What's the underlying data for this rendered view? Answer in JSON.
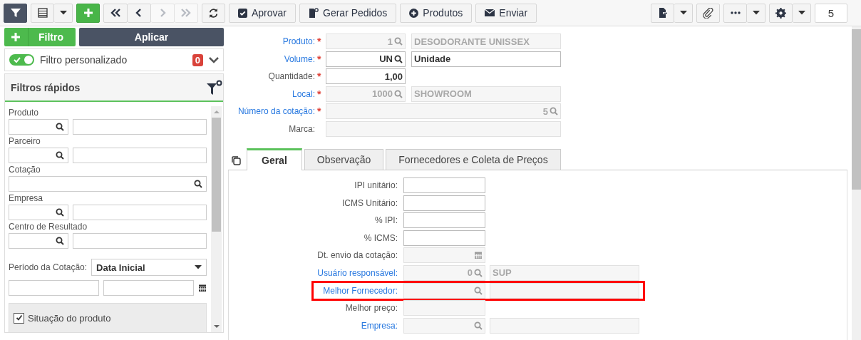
{
  "toolbar": {
    "nav": [
      {
        "disabled": false
      },
      {
        "disabled": false
      },
      {
        "disabled": true
      },
      {
        "disabled": true
      }
    ],
    "actions": [
      "Aprovar",
      "Gerar Pedidos",
      "Produtos",
      "Enviar"
    ],
    "record_count": "5"
  },
  "filter_panel": {
    "add_filter": "Filtro",
    "apply": "Aplicar",
    "custom_filter": {
      "label": "Filtro personalizado",
      "on": true,
      "count": "0"
    },
    "quick_filters": {
      "title": "Filtros rápidos",
      "fields": [
        {
          "kind": "lookup",
          "label": "Produto"
        },
        {
          "kind": "lookup",
          "label": "Parceiro"
        },
        {
          "kind": "search",
          "label": "Cotação"
        },
        {
          "kind": "lookup",
          "label": "Empresa"
        },
        {
          "kind": "lookup",
          "label": "Centro de Resultado"
        },
        {
          "kind": "period",
          "label": "Período da Cotação:",
          "value": "Data Inicial"
        },
        {
          "kind": "checkbox",
          "label": "Situação do produto",
          "checked": true
        }
      ]
    }
  },
  "form": {
    "fields": [
      {
        "kind": "lookup",
        "label": "Produto:",
        "link": true,
        "required_mark": "*",
        "readonly": true,
        "code": "1",
        "description": "DESODORANTE UNISSEX"
      },
      {
        "kind": "lookup",
        "label": "Volume:",
        "link": true,
        "required_mark": "*",
        "readonly": false,
        "code": "UN",
        "description": "Unidade"
      },
      {
        "kind": "number",
        "label": "Quantidade:",
        "link": false,
        "required_mark": "*",
        "readonly": false,
        "code": "1,00"
      },
      {
        "kind": "lookup",
        "label": "Local:",
        "link": true,
        "required_mark": "*",
        "readonly": true,
        "code": "1000",
        "description": "SHOWROOM"
      },
      {
        "kind": "wide_lookup",
        "label": "Número da cotação:",
        "link": true,
        "required_mark": "*",
        "readonly": true,
        "code": "5"
      },
      {
        "kind": "wide_text",
        "label": "Marca:",
        "link": false,
        "readonly": true
      }
    ],
    "tabs": [
      {
        "label": "Geral",
        "selected": true
      },
      {
        "label": "Observação",
        "selected": false
      },
      {
        "label": "Fornecedores e Coleta de Preços",
        "selected": false
      }
    ],
    "tab_fields": [
      {
        "kind": "text",
        "label": "IPI unitário:",
        "link": false,
        "readonly": false,
        "highlighted": false
      },
      {
        "kind": "text",
        "label": "ICMS Unitário:",
        "link": false,
        "readonly": false,
        "highlighted": false
      },
      {
        "kind": "text",
        "label": "% IPI:",
        "link": false,
        "readonly": false,
        "highlighted": false
      },
      {
        "kind": "text",
        "label": "% ICMS:",
        "link": false,
        "readonly": false,
        "highlighted": false
      },
      {
        "kind": "date",
        "label": "Dt. envio da cotação:",
        "link": false,
        "readonly": true,
        "highlighted": false
      },
      {
        "kind": "lookup",
        "label": "Usuário responsável:",
        "link": true,
        "readonly": true,
        "code": "0",
        "description": "SUP",
        "highlighted": false
      },
      {
        "kind": "lookup",
        "label": "Melhor Fornecedor:",
        "link": true,
        "readonly": true,
        "highlighted": true
      },
      {
        "kind": "text",
        "label": "Melhor preço:",
        "link": false,
        "readonly": true,
        "highlighted": false
      },
      {
        "kind": "lookup",
        "label": "Empresa:",
        "link": true,
        "readonly": true,
        "highlighted": false
      }
    ]
  }
}
